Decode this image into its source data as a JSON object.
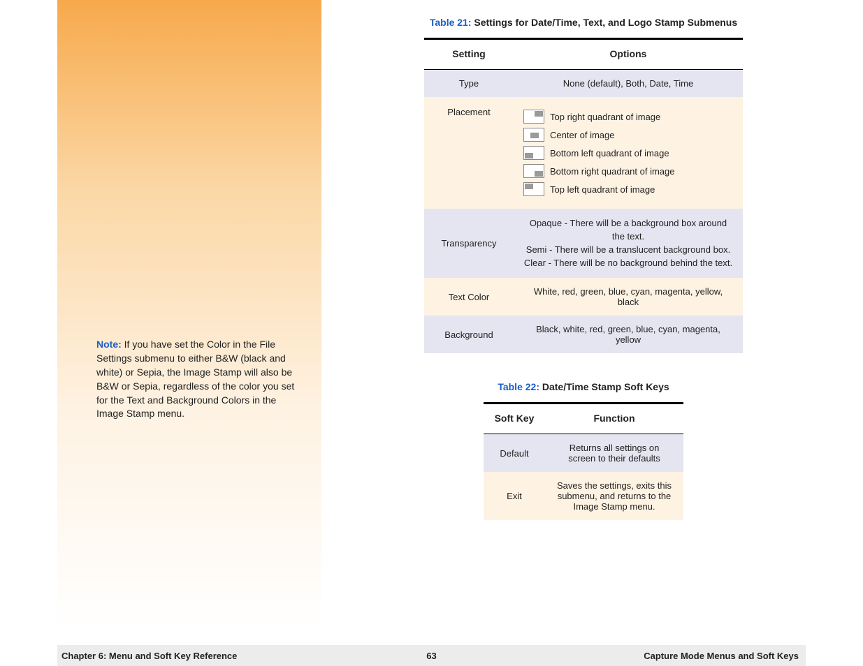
{
  "sidebar": {
    "note_label": "Note:",
    "note_text": " If you have set the Color in the File Settings submenu to either B&W (black and white) or Sepia, the Image Stamp will also be B&W or Sepia, regardless of the color you set for the Text and Background Colors in the Image Stamp menu."
  },
  "table21": {
    "caption_num": "Table 21:",
    "caption_text": " Settings for Date/Time, Text, and Logo Stamp Submenus",
    "head_setting": "Setting",
    "head_options": "Options",
    "rows": {
      "type": {
        "setting": "Type",
        "options": "None (default), Both, Date, Time"
      },
      "placement": {
        "setting": "Placement",
        "opts": [
          "Top right quadrant of image",
          "Center of image",
          "Bottom left quadrant of image",
          "Bottom right quadrant of image",
          "Top left quadrant of image"
        ]
      },
      "transparency": {
        "setting": "Transparency",
        "line1": "Opaque - There will be a background box around the text.",
        "line2": "Semi - There will be a translucent background box.",
        "line3": "Clear - There will be no background behind the text."
      },
      "textcolor": {
        "setting": "Text Color",
        "options": "White, red, green, blue, cyan, magenta, yellow, black"
      },
      "background": {
        "setting": "Background",
        "options": "Black, white, red, green, blue, cyan, magenta, yellow"
      }
    }
  },
  "table22": {
    "caption_num": "Table 22:",
    "caption_text": " Date/Time Stamp Soft Keys",
    "head_key": "Soft Key",
    "head_func": "Function",
    "rows": {
      "default": {
        "key": "Default",
        "func": "Returns all settings on screen to their defaults"
      },
      "exit": {
        "key": "Exit",
        "func": "Saves the settings, exits this submenu, and returns to the Image Stamp menu."
      }
    }
  },
  "footer": {
    "left": "Chapter 6: Menu and Soft Key Reference",
    "mid": "63",
    "right": "Capture Mode Menus and Soft Keys"
  }
}
